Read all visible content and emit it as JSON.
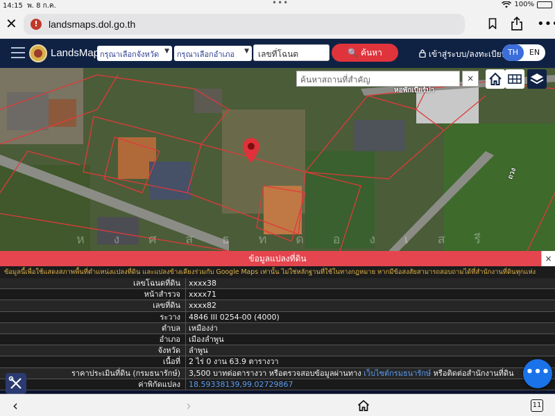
{
  "status_bar": {
    "time": "14:15",
    "date": "พ. 8 ก.ค.",
    "battery": "100%"
  },
  "browser": {
    "url": "landsmaps.dol.go.th",
    "tab_count": "11",
    "icons": [
      "close-icon",
      "warning-icon",
      "bookmark-icon",
      "share-icon",
      "more-icon",
      "back-icon",
      "forward-icon",
      "home-icon",
      "tabs-icon"
    ]
  },
  "header": {
    "brand": "LandsMaps",
    "province_placeholder": "กรุณาเลือกจังหวัด",
    "district_placeholder": "กรุณาเลือกอำเภอ",
    "deed_placeholder": "เลขที่โฉนด",
    "search_label": "ค้นหา",
    "login_label": "เข้าสู่ระบบ/ลงทะเบียน",
    "lang_th": "TH",
    "lang_en": "EN",
    "accent_color": "#e0343c"
  },
  "map": {
    "place_search_placeholder": "ค้นหาสถานที่สำคัญ",
    "place_clear": "×",
    "label_top_right": "หอพักเบียร์ปา",
    "label_road": "ถวง",
    "watermark": "ห ง ศ ส ธ ท ด อ ง เ ส รี"
  },
  "parcel_panel": {
    "title": "ข้อมูลแปลงที่ดิน",
    "close": "×",
    "notice": "ข้อมูลนี้เพื่อใช้แสดงสภาพพื้นที่ตำแหน่งแปลงที่ดิน และแปลงข้างเคียงร่วมกับ Google Maps เท่านั้น ไม่ใช่หลักฐานที่ใช้ในทางกฎหมาย หากมีข้อสงสัยสามารถสอบถามได้ที่สำนักงานที่ดินทุกแห่ง",
    "rows": [
      {
        "label": "เลขโฉนดที่ดิน",
        "value": "xxxx38"
      },
      {
        "label": "หน้าสำรวจ",
        "value": "xxxx71"
      },
      {
        "label": "เลขที่ดิน",
        "value": "xxxx82"
      },
      {
        "label": "ระวาง",
        "value": "4846 III 0254-00 (4000)"
      },
      {
        "label": "ตำบล",
        "value": "เหมืองง่า"
      },
      {
        "label": "อำเภอ",
        "value": "เมืองลำพูน"
      },
      {
        "label": "จังหวัด",
        "value": "ลำพูน"
      },
      {
        "label": "เนื้อที่",
        "value": "2 ไร่ 0 งาน 63.9 ตารางวา"
      }
    ],
    "price_row": {
      "label": "ราคาประเมินที่ดิน (กรมธนารักษ์)",
      "value_pre": "3,500 บาทต่อตารางวา หรือตรวจสอบข้อมูลผ่านทาง ",
      "value_link": "เว็บไซต์กรมธนารักษ์",
      "value_post": " หรือติดต่อสำนักงานที่ดิน"
    },
    "coords_row": {
      "label": "ค่าพิกัดแปลง",
      "value": "18.59338139,99.02729867"
    }
  },
  "chat_fab_label": "•••"
}
